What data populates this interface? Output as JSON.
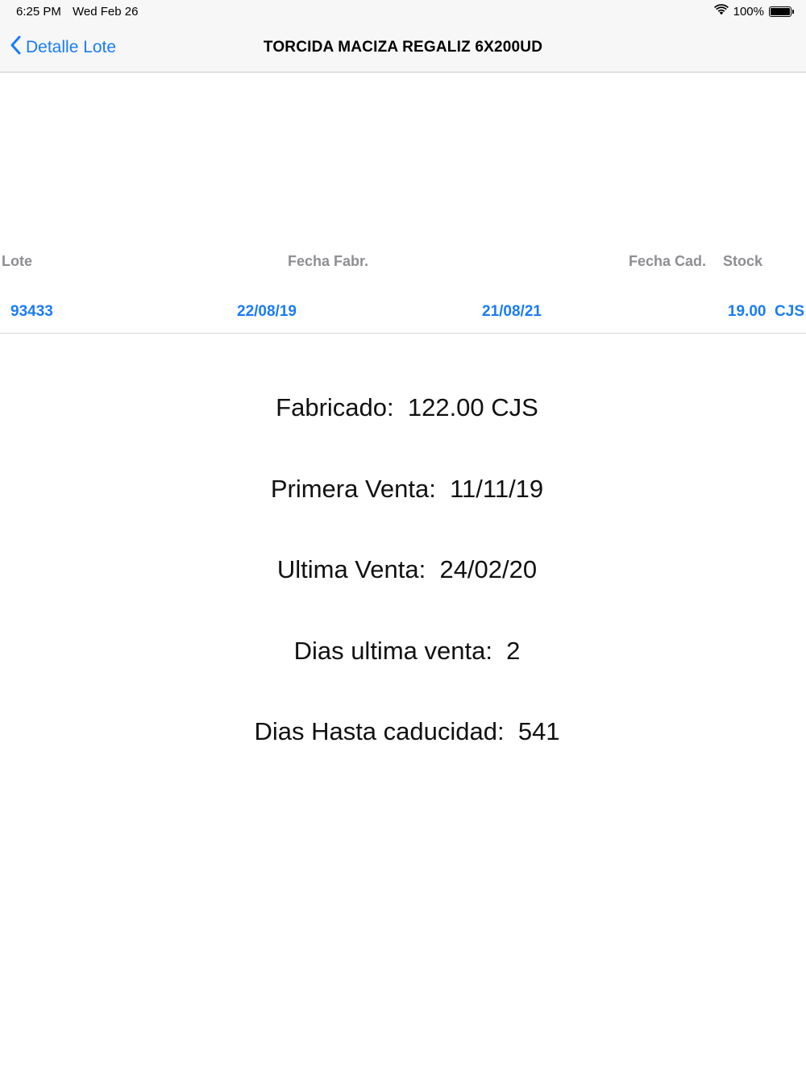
{
  "status": {
    "time": "6:25 PM",
    "date": "Wed Feb 26",
    "battery": "100%"
  },
  "nav": {
    "back_label": "Detalle Lote",
    "title": "TORCIDA MACIZA REGALIZ 6X200UD"
  },
  "table": {
    "headers": {
      "lote": "Lote",
      "fecha_fabr": "Fecha Fabr.",
      "fecha_cad": "Fecha Cad.",
      "stock": "Stock"
    },
    "row": {
      "lote": "93433",
      "fecha_fabr": "22/08/19",
      "fecha_cad": "21/08/21",
      "stock": "19.00  CJS"
    }
  },
  "summary": {
    "fabricado": "Fabricado:  122.00 CJS",
    "primera_venta": "Primera Venta:  11/11/19",
    "ultima_venta": "Ultima Venta:  24/02/20",
    "dias_ultima_venta": "Dias ultima venta:  2",
    "dias_hasta_caducidad": "Dias Hasta caducidad:  541"
  },
  "colors": {
    "accent": "#1a7cf5",
    "header_gray": "#8e8e93",
    "bar_background": "#f7f7f7"
  },
  "icons": {
    "back": "chevron-left-icon",
    "wifi": "wifi-icon",
    "battery": "battery-icon"
  }
}
